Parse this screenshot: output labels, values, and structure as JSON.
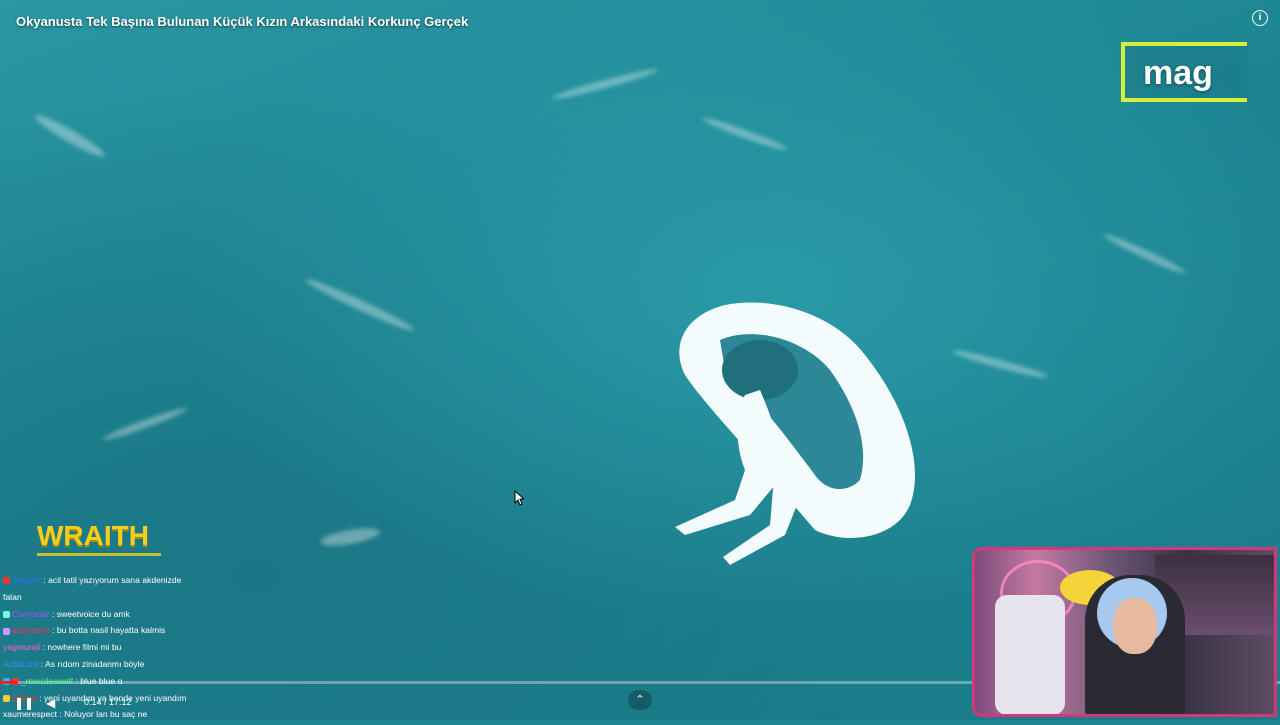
{
  "video": {
    "title": "Okyanusta Tek Başına Bulunan Küçük Kızın Arkasındaki Korkunç Gerçek",
    "channel_logo": "mag",
    "info_icon": "info-icon",
    "progress_fraction": 0.014,
    "time": "0:14 / 17:12"
  },
  "overlay": {
    "streamer_logo": "WRAITH"
  },
  "chat": [
    {
      "user": "Vasgurt",
      "text": ": acil tatil yazıyorum sana akdenizde",
      "color": "#2a6fff"
    },
    {
      "user": "",
      "text": "falan",
      "color": "#ffffff"
    },
    {
      "user": "CanYasar",
      "text": ": sweetvoice du amk",
      "color": "#b04cff"
    },
    {
      "user": "adamsmo",
      "text": ": bu botta nasil hayatta kalmis",
      "color": "#ff2d55"
    },
    {
      "user": "yagmuroli",
      "text": ": nowhere filmi mi bu",
      "color": "#ff5fd1"
    },
    {
      "user": "ArdaLord",
      "text": ": As rıdom zinadanmı böyle",
      "color": "#3d8bff"
    },
    {
      "user": "_mercileswolf",
      "text": ": blue blue o",
      "color": "#3dff6a"
    },
    {
      "user": "Sibora",
      "text": ": yeni uyandım ya bende yeni uyandım",
      "color": "#ff2d2d"
    },
    {
      "user": "xaumerespect",
      "text": ": Noluyor lan bu saç ne",
      "color": "#ffffff"
    }
  ],
  "colors": {
    "accent_logo": "#d6f03a",
    "wraith": "#f3cf1d",
    "webcam_border": "#d6367b",
    "progress": "#ff1e1e"
  }
}
